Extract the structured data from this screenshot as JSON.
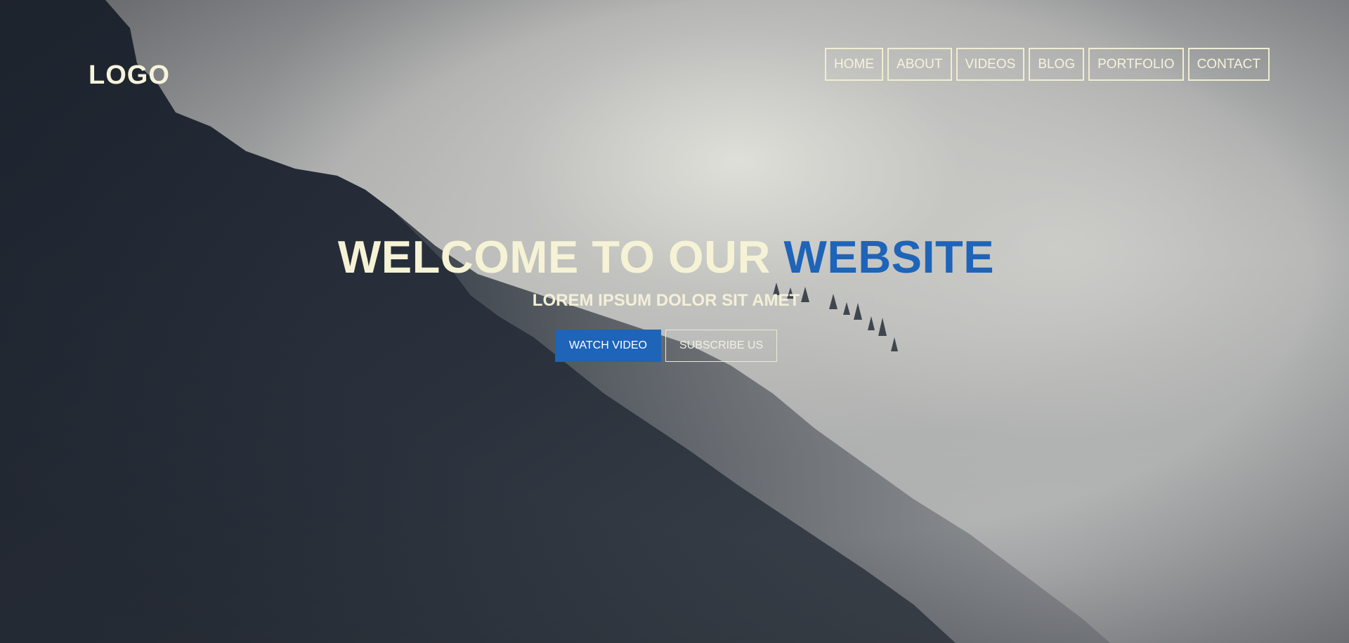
{
  "header": {
    "logo": "LOGO",
    "nav": [
      {
        "label": "HOME"
      },
      {
        "label": "ABOUT"
      },
      {
        "label": "VIDEOS"
      },
      {
        "label": "BLOG"
      },
      {
        "label": "PORTFOLIO"
      },
      {
        "label": "CONTACT"
      }
    ]
  },
  "hero": {
    "title_main": "WELCOME TO OUR",
    "title_accent": "WEBSITE",
    "subtitle": "LOREM IPSUM DOLOR SIT AMET",
    "primary_button": "WATCH VIDEO",
    "secondary_button": "SUBSCRIBE US"
  },
  "colors": {
    "accent": "#1e64b8",
    "text_light": "#f6f3dc",
    "mountain_dark": "#1b2230"
  }
}
